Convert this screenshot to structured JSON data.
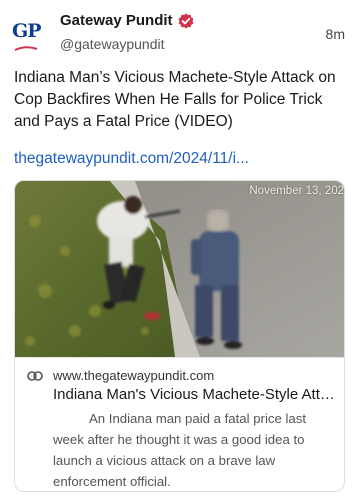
{
  "account": {
    "avatar_text": "GP",
    "display_name": "Gateway Pundit",
    "handle": "@gatewaypundit",
    "verified_icon": "verified-badge-icon",
    "brand_color": "#0f3f8f",
    "verified_color": "#d0344f"
  },
  "post": {
    "timestamp": "8m",
    "text": "Indiana Man’s Vicious Machete-Style Attack on Cop Backfires When He Falls for Police Trick and Pays a Fatal Price (VIDEO)",
    "link_text": "thegatewaypundit.com/2024/11/i...",
    "link_color": "#1f5fbf"
  },
  "card": {
    "video_stamp": "November 13, 202",
    "link_icon": "link-icon",
    "domain": "www.thegatewaypundit.com",
    "title": "Indiana Man's Vicious Machete-Style Attack on Cop Backfires When He Falls for Police Trick and Pays a Fatal Price (VIDEO)",
    "description": "An Indiana man paid a fatal price last week after he thought it was a good idea to launch a vicious attack on a brave law enforcement official."
  }
}
